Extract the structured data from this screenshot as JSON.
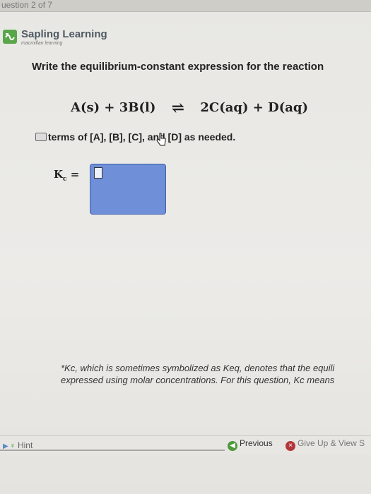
{
  "header": {
    "question_counter": "uestion 2 of 7"
  },
  "brand": {
    "name": "Sapling Learning",
    "subname": "macmillan learning"
  },
  "question": {
    "prompt": "Write the equilibrium-constant expression for the reaction",
    "reaction_left": "A(s) + 3B(l)",
    "reaction_arrow": "⇌",
    "reaction_right": "2C(aq) + D(aq)",
    "instruction": "terms of [A], [B], [C], and [D] as needed.",
    "kc_label": "K",
    "kc_subscript": "c",
    "kc_equals": "="
  },
  "footnote": {
    "line1": "*Kc, which is sometimes symbolized as Keq, denotes that the equili",
    "line2": "expressed using molar concentrations. For this question, Kc means"
  },
  "bottom": {
    "hint": "Hint",
    "previous": "Previous",
    "give_up": "Give Up & View S"
  },
  "colors": {
    "answer_box": "#6f8fd8",
    "logo_green": "#5aa64a",
    "previous_green": "#4f9a3a",
    "giveup_red": "#b3373a"
  },
  "icons": {
    "logo": "sapling-logo-icon",
    "hint_play": "play-icon",
    "hint_bulb": "lightbulb-icon",
    "previous": "previous-circle-icon",
    "give_up": "close-circle-icon",
    "cursor": "hand-cursor-icon",
    "instruction": "equation-editor-icon"
  }
}
